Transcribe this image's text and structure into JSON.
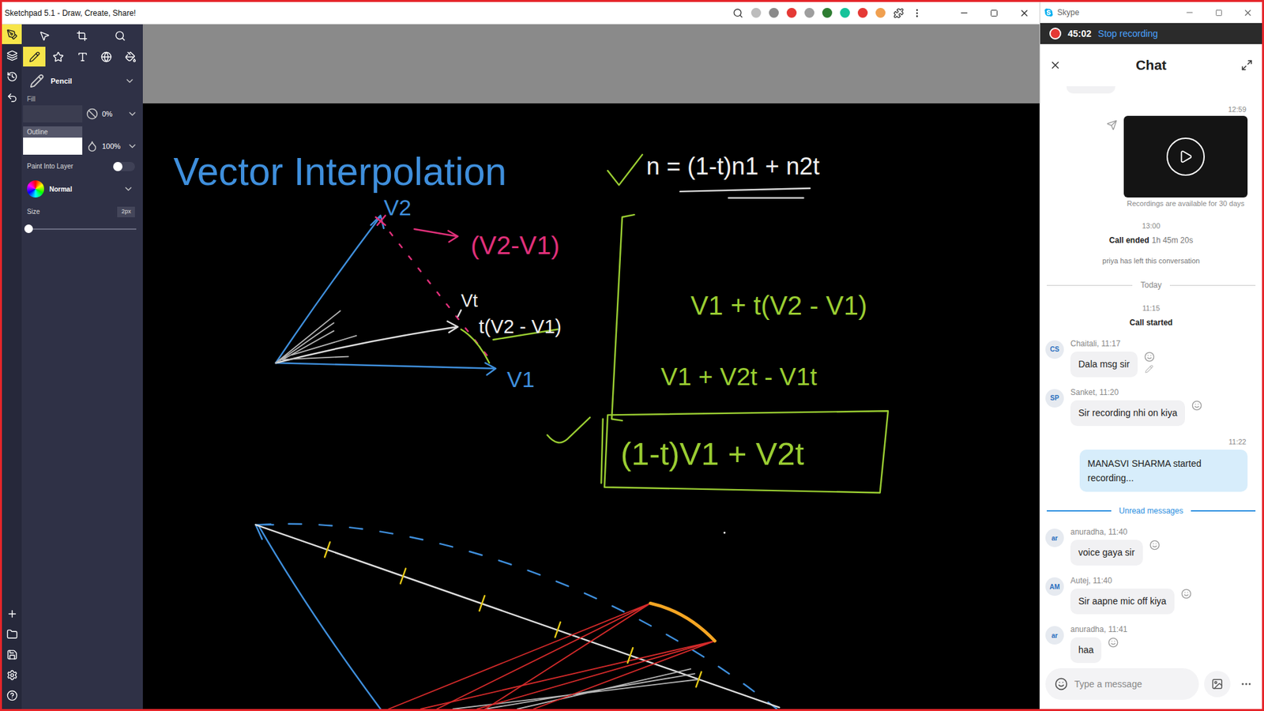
{
  "sketchpad": {
    "title": "Sketchpad 5.1 - Draw, Create, Share!",
    "side_tools": [
      {
        "kind": "logo",
        "selected": true
      },
      {
        "kind": "layers",
        "selected": false
      },
      {
        "kind": "history",
        "selected": false
      },
      {
        "kind": "undo",
        "selected": false
      }
    ],
    "file_tools": [
      {
        "kind": "add",
        "selected": false
      },
      {
        "kind": "open",
        "selected": false
      },
      {
        "kind": "save",
        "selected": false
      },
      {
        "kind": "settings",
        "selected": false
      },
      {
        "kind": "help",
        "selected": false
      }
    ],
    "tool_rows": [
      [
        {
          "kind": "select",
          "selected": false
        },
        {
          "kind": "crop",
          "selected": false
        },
        {
          "kind": "zoom",
          "selected": false
        }
      ],
      [
        {
          "kind": "pencil",
          "selected": true
        },
        {
          "kind": "shape",
          "selected": false
        },
        {
          "kind": "text",
          "selected": false
        },
        {
          "kind": "sticker",
          "selected": false
        },
        {
          "kind": "fill",
          "selected": false
        }
      ]
    ],
    "brush": "Pencil",
    "fill": {
      "label": "Fill",
      "value": "0%"
    },
    "outline": {
      "label": "Outline",
      "value": "100%"
    },
    "paint_into_layer": {
      "label": "Paint Into Layer",
      "on": false
    },
    "blend_mode": "Normal",
    "size": {
      "label": "Size",
      "value": "2px",
      "level": 0
    }
  },
  "canvas": {
    "annotations": [
      {
        "text": "Vector Interpolation",
        "color": "#3f8fdc"
      },
      {
        "text": "V2",
        "color": "#3f8fdc"
      },
      {
        "text": "(V2-V1)",
        "color": "#e0307a"
      },
      {
        "text": "Vt",
        "color": "#eeeeee"
      },
      {
        "text": "t(V2 - V1)",
        "color": "#eeeeee"
      },
      {
        "text": "V1",
        "color": "#3f8fdc"
      },
      {
        "text": "n = (1-t)n1 + n2t",
        "color": "#eeeeee"
      },
      {
        "text": "V1 + t(V2 - V1)",
        "color": "#9acd32"
      },
      {
        "text": "V1 + V2t - V1t",
        "color": "#9acd32"
      },
      {
        "text": "(1-t)V1 + V2t",
        "color": "#9acd32"
      }
    ]
  },
  "skype": {
    "title": "Skype",
    "recording": {
      "time": "45:02",
      "action": "Stop recording"
    },
    "chat_title": "Chat",
    "feed": [
      {
        "kind": "cut"
      },
      {
        "kind": "own_time",
        "text": "12:59"
      },
      {
        "kind": "video",
        "caption": "Recordings are available for 30 days"
      },
      {
        "kind": "time",
        "text": "13:00"
      },
      {
        "kind": "event",
        "title": "Call ended",
        "detail": "1h 45m 20s"
      },
      {
        "kind": "system",
        "text": "priya has left this conversation"
      },
      {
        "kind": "divider",
        "text": "Today",
        "unread": false
      },
      {
        "kind": "time",
        "text": "11:15"
      },
      {
        "kind": "event",
        "title": "Call started"
      },
      {
        "kind": "message",
        "initials": "CS",
        "sender": "Chaitali, 11:17",
        "text": "Dala msg sir",
        "editable": true
      },
      {
        "kind": "message",
        "initials": "SP",
        "sender": "Sanket, 11:20",
        "text": "Sir recording nhi on kiya",
        "editable": false
      },
      {
        "kind": "own_time",
        "text": "11:22"
      },
      {
        "kind": "own",
        "text": "MANASVI SHARMA started recording..."
      },
      {
        "kind": "divider",
        "text": "Unread messages",
        "unread": true
      },
      {
        "kind": "message",
        "initials": "ar",
        "sender": "anuradha, 11:40",
        "text": "voice gaya sir",
        "editable": false
      },
      {
        "kind": "message",
        "initials": "AM",
        "sender": "Autej, 11:40",
        "text": "Sir aapne mic off kiya",
        "editable": false
      },
      {
        "kind": "message",
        "initials": "ar",
        "sender": "anuradha, 11:41",
        "text": "haa",
        "editable": false
      }
    ],
    "input": {
      "placeholder": "Type a message"
    }
  }
}
